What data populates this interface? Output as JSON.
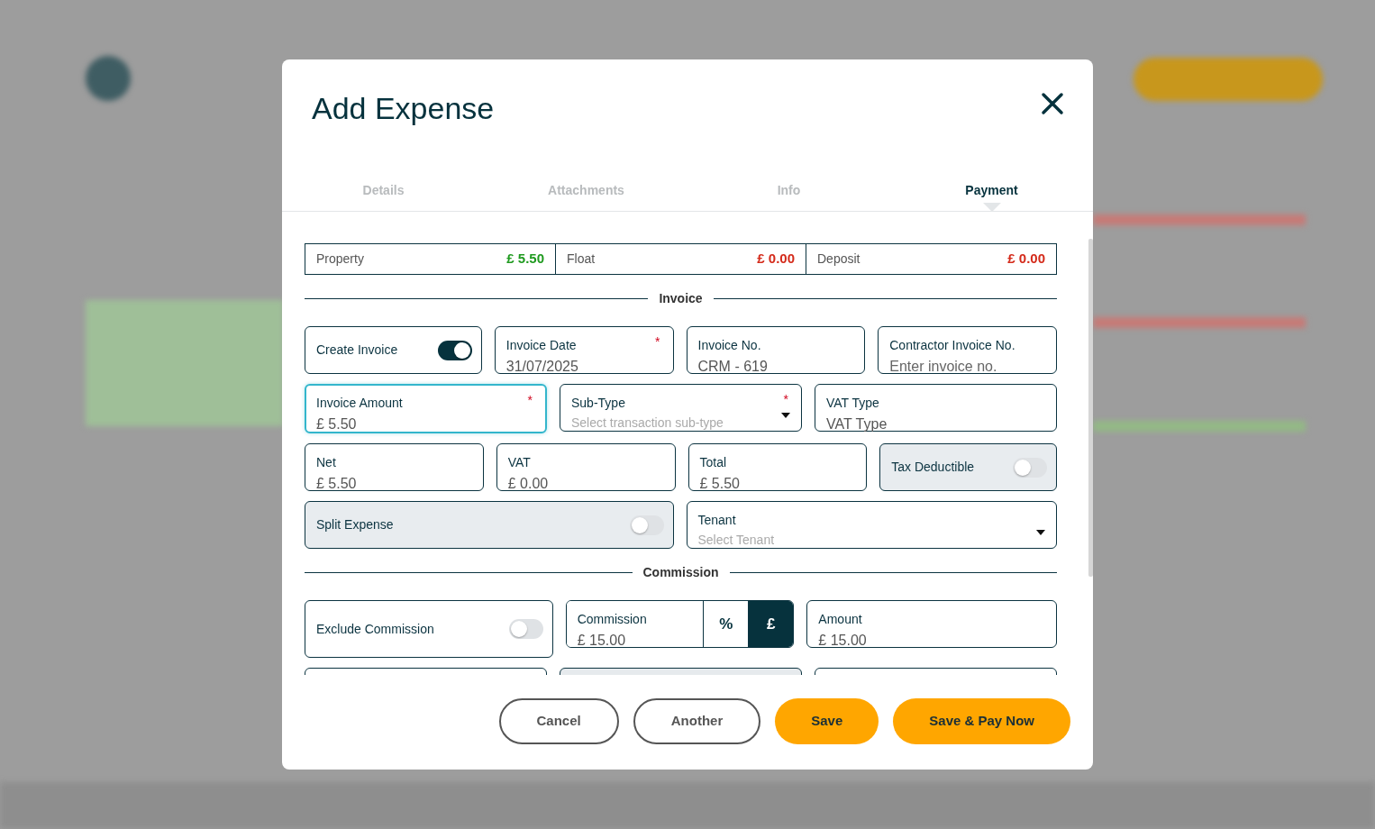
{
  "dialog": {
    "title": "Add Expense"
  },
  "tabs": [
    {
      "label": "Details",
      "selected": false
    },
    {
      "label": "Attachments",
      "selected": false
    },
    {
      "label": "Info",
      "selected": false
    },
    {
      "label": "Payment",
      "selected": true
    }
  ],
  "balances": [
    {
      "label": "Property",
      "amount": "£ 5.50",
      "color": "#1f9a1f"
    },
    {
      "label": "Float",
      "amount": "£ 0.00",
      "color": "#d42a1a"
    },
    {
      "label": "Deposit",
      "amount": "£ 0.00",
      "color": "#d42a1a"
    }
  ],
  "sections": [
    {
      "title": "Invoice",
      "rows": [
        [
          {
            "kind": "toggle",
            "label": "Create Invoice",
            "on": true,
            "disabled": false
          },
          {
            "kind": "input",
            "label": "Invoice Date",
            "value": "31/07/2025",
            "marker": "*",
            "focused": false
          },
          {
            "kind": "input",
            "label": "Invoice No.",
            "value": "CRM - 619",
            "focused": false
          },
          {
            "kind": "input",
            "label": "Contractor Invoice No.",
            "placeholder": "Enter invoice no.",
            "focused": false
          }
        ],
        [
          {
            "kind": "input",
            "label": "Invoice Amount",
            "value": "£ 5.50",
            "marker": "*",
            "focused": true
          },
          {
            "kind": "select",
            "label": "Sub-Type",
            "placeholder": "Select transaction sub-type",
            "marker": "*"
          },
          {
            "kind": "input",
            "label": "VAT Type",
            "value": "VAT Type",
            "focused": false
          }
        ],
        [
          {
            "kind": "input",
            "label": "Net",
            "value": "£ 5.50",
            "focused": false
          },
          {
            "kind": "input",
            "label": "VAT",
            "value": "£ 0.00",
            "focused": false
          },
          {
            "kind": "input",
            "label": "Total",
            "value": "£ 5.50",
            "focused": false
          },
          {
            "kind": "toggle",
            "label": "Tax Deductible",
            "on": false,
            "disabled": true
          }
        ],
        [
          {
            "kind": "toggle",
            "label": "Split Expense",
            "on": false,
            "disabled": true
          },
          {
            "kind": "select",
            "label": "Tenant",
            "placeholder": "Select Tenant"
          }
        ]
      ]
    },
    {
      "title": "Commission",
      "rows": [
        [
          {
            "kind": "toggle",
            "label": "Exclude Commission",
            "on": false,
            "disabled": false
          },
          {
            "kind": "unit_input",
            "label": "Commission",
            "value": "£ 15.00",
            "units": [
              {
                "label": "%",
                "selected": false
              },
              {
                "label": "£",
                "selected": true
              }
            ]
          },
          {
            "kind": "input",
            "label": "Amount",
            "value": "£ 15.00",
            "focused": false
          }
        ],
        [
          {
            "kind": "partial",
            "disabled": false
          },
          {
            "kind": "partial",
            "disabled": true
          },
          {
            "kind": "partial",
            "disabled": false
          }
        ]
      ]
    }
  ],
  "buttons": [
    {
      "label": "Cancel",
      "kind": "outline"
    },
    {
      "label": "Another",
      "kind": "outline"
    },
    {
      "label": "Save",
      "kind": "primary"
    },
    {
      "label": "Save & Pay Now",
      "kind": "primary"
    }
  ]
}
